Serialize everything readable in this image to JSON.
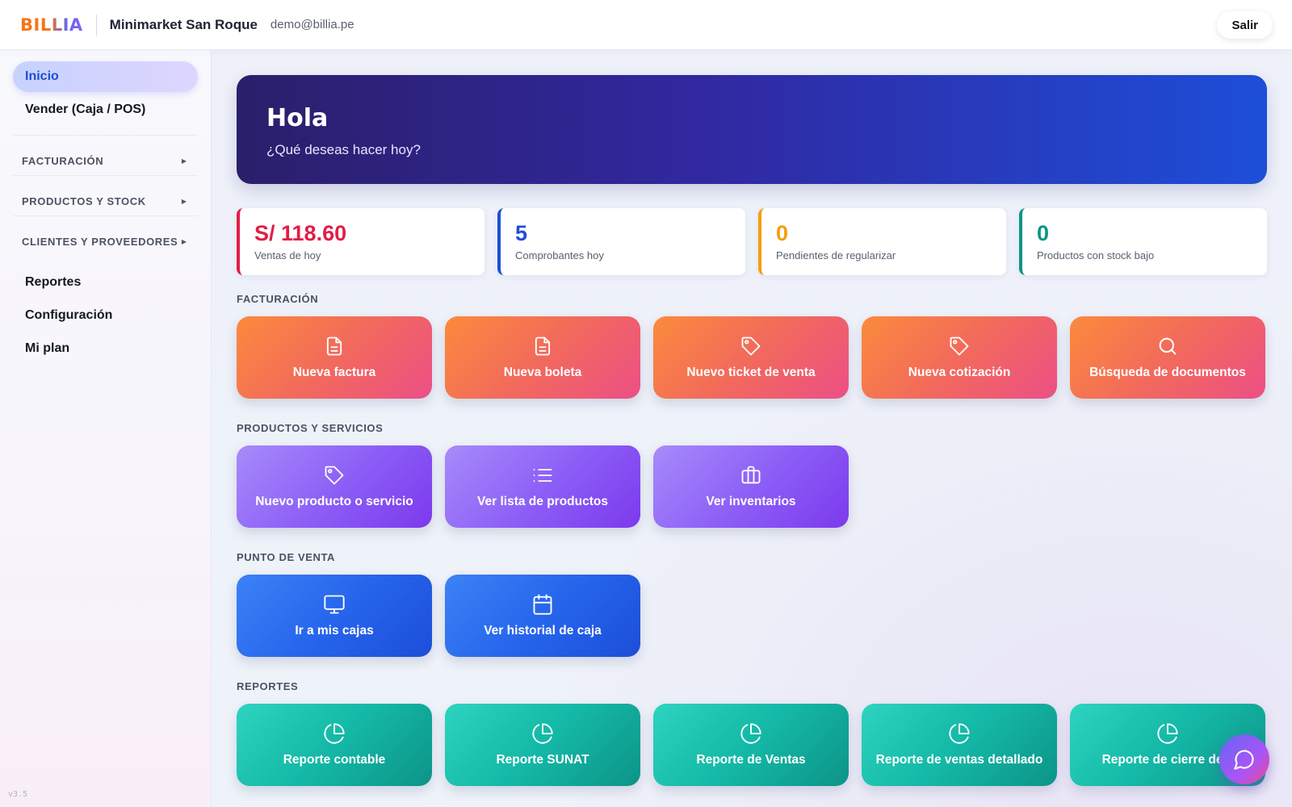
{
  "header": {
    "logo": "BILLIA",
    "store_name": "Minimarket San Roque",
    "email": "demo@billia.pe",
    "logout_label": "Salir"
  },
  "sidebar": {
    "items": [
      {
        "label": "Inicio",
        "active": true
      },
      {
        "label": "Vender (Caja / POS)"
      }
    ],
    "groups": [
      {
        "label": "FACTURACIÓN",
        "icon": "caret-right-icon"
      },
      {
        "label": "PRODUCTOS Y STOCK",
        "icon": "caret-right-icon"
      },
      {
        "label": "CLIENTES Y PROVEEDORES",
        "icon": "caret-right-icon"
      }
    ],
    "bottom_items": [
      {
        "label": "Reportes"
      },
      {
        "label": "Configuración"
      },
      {
        "label": "Mi plan"
      }
    ],
    "version": "v3.5"
  },
  "hero": {
    "title": "Hola",
    "subtitle": "¿Qué deseas hacer hoy?"
  },
  "stats": [
    {
      "value": "S/ 118.60",
      "label": "Ventas de hoy",
      "color": "#e11d48"
    },
    {
      "value": "5",
      "label": "Comprobantes hoy",
      "color": "#1d4ed8"
    },
    {
      "value": "0",
      "label": "Pendientes de regularizar",
      "color": "#f59e0b"
    },
    {
      "value": "0",
      "label": "Productos con stock bajo",
      "color": "#0d9488"
    }
  ],
  "sections": {
    "facturacion": {
      "title": "FACTURACIÓN",
      "tiles": [
        {
          "label": "Nueva factura",
          "icon": "document-icon"
        },
        {
          "label": "Nueva boleta",
          "icon": "document-icon"
        },
        {
          "label": "Nuevo ticket de venta",
          "icon": "tag-icon"
        },
        {
          "label": "Nueva cotización",
          "icon": "tag-icon"
        },
        {
          "label": "Búsqueda de documentos",
          "icon": "search-icon"
        }
      ]
    },
    "productos": {
      "title": "PRODUCTOS Y SERVICIOS",
      "tiles": [
        {
          "label": "Nuevo producto o servicio",
          "icon": "tag-icon"
        },
        {
          "label": "Ver lista de productos",
          "icon": "list-icon"
        },
        {
          "label": "Ver inventarios",
          "icon": "briefcase-icon"
        }
      ]
    },
    "pos": {
      "title": "PUNTO DE VENTA",
      "tiles": [
        {
          "label": "Ir a mis cajas",
          "icon": "monitor-icon"
        },
        {
          "label": "Ver historial de caja",
          "icon": "calendar-icon"
        }
      ]
    },
    "reportes": {
      "title": "REPORTES",
      "tiles": [
        {
          "label": "Reporte contable",
          "icon": "pie-chart-icon"
        },
        {
          "label": "Reporte SUNAT",
          "icon": "pie-chart-icon"
        },
        {
          "label": "Reporte de Ventas",
          "icon": "pie-chart-icon"
        },
        {
          "label": "Reporte de ventas detallado",
          "icon": "pie-chart-icon"
        },
        {
          "label": "Reporte de cierre de c",
          "icon": "pie-chart-icon"
        }
      ]
    }
  },
  "chat_button": {
    "icon": "chat-bubble-icon"
  }
}
